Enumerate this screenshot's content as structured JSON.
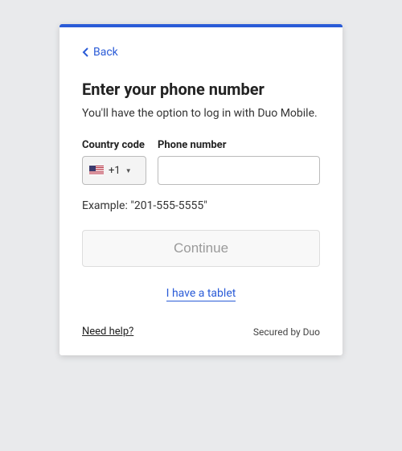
{
  "back": {
    "label": "Back"
  },
  "title": "Enter your phone number",
  "subtitle": "You'll have the option to log in with Duo Mobile.",
  "fields": {
    "country_code": {
      "label": "Country code",
      "value": "+1"
    },
    "phone_number": {
      "label": "Phone number",
      "value": ""
    }
  },
  "example": "Example: \"201-555-5555\"",
  "continue_label": "Continue",
  "tablet_link": "I have a tablet",
  "footer": {
    "help": "Need help?",
    "secured": "Secured by Duo"
  }
}
